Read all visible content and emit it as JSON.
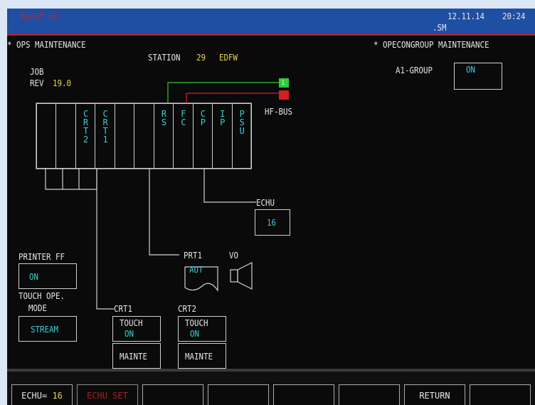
{
  "titlebar": {
    "alarm": "= ALARM 03",
    "date": "12.11.14",
    "time": "20:24",
    "sub": ".SM"
  },
  "header": {
    "left": "* OPS MAINTENANCE",
    "right": "* OPECONGROUP MAINTENANCE"
  },
  "station": {
    "label": "STATION",
    "number": "29",
    "name": "EDFW"
  },
  "job": {
    "label": "JOB",
    "rev_label": "REV",
    "rev": "19.0"
  },
  "group": {
    "label": "A1-GROUP",
    "value": "ON"
  },
  "hfbus": {
    "label": "HF-BUS",
    "top": "1",
    "bottom": "2"
  },
  "slots": [
    {
      "text": ""
    },
    {
      "text": ""
    },
    {
      "text": "CRT2"
    },
    {
      "text": "CRT1"
    },
    {
      "text": ""
    },
    {
      "text": ""
    },
    {
      "text": "RS"
    },
    {
      "text": "FC"
    },
    {
      "text": "CP"
    },
    {
      "text": "IP"
    },
    {
      "text": "PSU"
    }
  ],
  "echu": {
    "label": "ECHU",
    "value": "16"
  },
  "prt1": {
    "label": "PRT1",
    "mode": "AUT"
  },
  "vo": {
    "label": "VO"
  },
  "printer_ff": {
    "label": "PRINTER FF",
    "value": "ON"
  },
  "touch_ope": {
    "label1": "TOUCH OPE.",
    "label2": "MODE",
    "value": "STREAM"
  },
  "crt1": {
    "label": "CRT1",
    "touch": "TOUCH",
    "state": "ON",
    "mode": "MAINTE"
  },
  "crt2": {
    "label": "CRT2",
    "touch": "TOUCH",
    "state": "ON",
    "mode": "MAINTE"
  },
  "fkeys": {
    "echu_label": "ECHU=",
    "echu_value": "16",
    "echu_set": "ECHU SET",
    "return": "RETURN"
  },
  "colors": {
    "background": "#0a0a0a",
    "titlebar": "#1f4fa2",
    "cyan": "#37d0d8",
    "yellow": "#e6d645",
    "red": "#d42020",
    "green": "#2ecc2e"
  }
}
